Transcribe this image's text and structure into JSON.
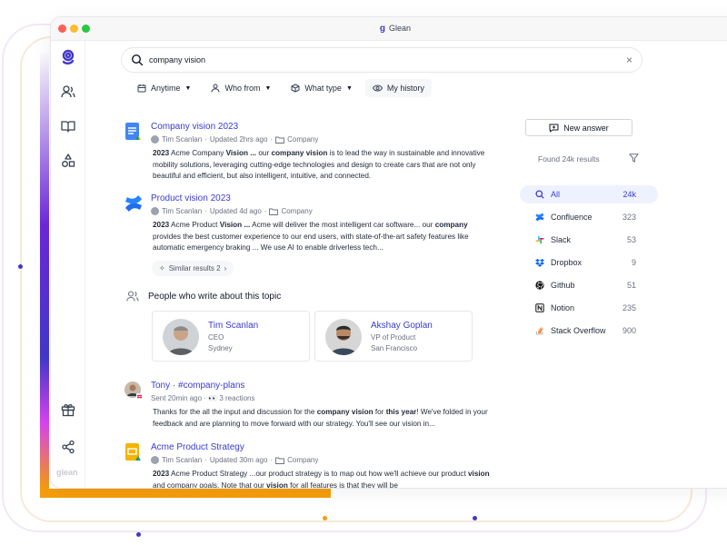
{
  "window": {
    "title": "Glean"
  },
  "sidebar": {
    "wordmark": "glean"
  },
  "search": {
    "query": "company vision"
  },
  "filters": [
    {
      "label": "Anytime",
      "icon": "calendar-icon",
      "dropdown": true
    },
    {
      "label": "Who from",
      "icon": "person-icon",
      "dropdown": true
    },
    {
      "label": "What type",
      "icon": "cube-icon",
      "dropdown": true
    },
    {
      "label": "My history",
      "icon": "eye-icon",
      "dropdown": false
    }
  ],
  "results": [
    {
      "title": "Company vision 2023",
      "author": "Tim Scanlan",
      "updated": "Updated 2hrs ago",
      "folder": "Company",
      "snippet_html": "<b>2023</b> Acme Company <b>Vision ...</b> our <b>company vision</b> is to lead the way in sustainable and innovative mobility solutions, leveraging cutting-edge technologies and design to create cars that are not only beautiful and efficient, but also intelligent, intuitive, and connected."
    },
    {
      "title": "Product vision 2023",
      "author": "Tim Scanlan",
      "updated": "Updated 4d ago",
      "folder": "Company",
      "snippet_html": "<b>2023</b> Acme Product <b>Vision ...</b> Acme will deliver the most intelligent car software... our <b>company</b> provides the best customer experience to our end users, with state-of-the-art safety features like automatic emergency braking ... We use AI to enable driverless tech..."
    },
    {
      "title": "Tony · #company-plans",
      "meta": "Sent 20min ago · 👀 3 reactions",
      "snippet_html": "Thanks for the all the input and discussion for the <b>company vision</b> for <b>this year</b>! We've folded in your feedback and are planning to move forward with our strategy. You'll see our vision in..."
    },
    {
      "title": "Acme Product Strategy",
      "author": "Tim Scanlan",
      "updated": "Updated 30m ago",
      "folder": "Company",
      "snippet_html": "<b>2023</b> Acme Product Strategy ...our product strategy is to map out how we'll achieve our product <b>vision</b> and company goals. Note that our <b>vision</b> for all features is that they will be"
    }
  ],
  "similar_results": "Similar results  2",
  "people": {
    "heading": "People who write about this topic",
    "cards": [
      {
        "name": "Tim Scanlan",
        "role": "CEO",
        "location": "Sydney"
      },
      {
        "name": "Akshay Goplan",
        "role": "VP of Product",
        "location": "San Francisco"
      }
    ]
  },
  "right_panel": {
    "new_answer": "New answer",
    "found": "Found 24k results",
    "sources": [
      {
        "label": "All",
        "count": "24k",
        "icon": "search-icon",
        "color": "#3b3bcf",
        "active": true
      },
      {
        "label": "Confluence",
        "count": "323",
        "icon": "confluence-icon",
        "color": "#1f6feb"
      },
      {
        "label": "Slack",
        "count": "53",
        "icon": "slack-icon",
        "color": "#e01e5a"
      },
      {
        "label": "Dropbox",
        "count": "9",
        "icon": "dropbox-icon",
        "color": "#0061fe"
      },
      {
        "label": "Github",
        "count": "51",
        "icon": "github-icon",
        "color": "#111111"
      },
      {
        "label": "Notion",
        "count": "235",
        "icon": "notion-icon",
        "color": "#111111"
      },
      {
        "label": "Stack Overflow",
        "count": "900",
        "icon": "stackoverflow-icon",
        "color": "#f48024"
      }
    ]
  }
}
